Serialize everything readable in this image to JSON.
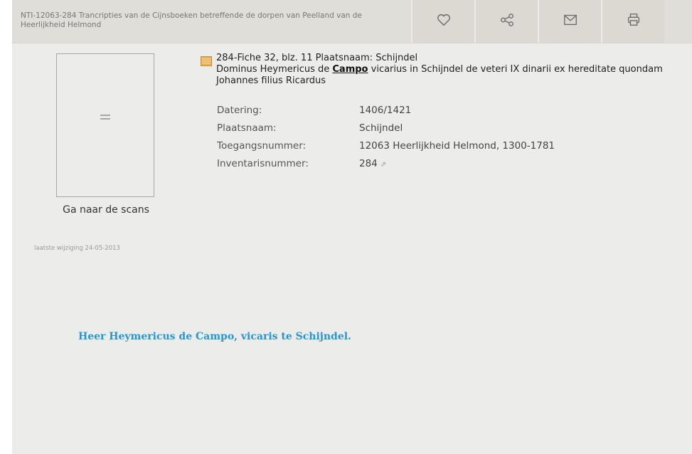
{
  "header": {
    "breadcrumb": "NTI-12063-284 Trancripties van de Cijnsboeken betreffende de dorpen van Peelland van de Heerlijkheid Helmond",
    "actions": [
      {
        "icon": "heart-icon"
      },
      {
        "icon": "share-icon"
      },
      {
        "icon": "mail-icon"
      },
      {
        "icon": "print-icon"
      }
    ]
  },
  "scans": {
    "link_label": "Ga naar de scans",
    "last_modified": "laatste wijziging 24-05-2013"
  },
  "record": {
    "title": "284-Fiche 32, blz. 11 Plaatsnaam: Schijndel",
    "desc_pre": "Dominus Heymericus de ",
    "desc_link": "Campo",
    "desc_post": " vicarius in Schijndel de veteri IX dinarii ex hereditate quondam Johannes filius Ricardus",
    "fields": [
      {
        "label": "Datering:",
        "value": "1406/1421"
      },
      {
        "label": "Plaatsnaam:",
        "value": "Schijndel"
      },
      {
        "label": "Toegangsnummer:",
        "value": "12063 Heerlijkheid Helmond, 1300-1781"
      },
      {
        "label": "Inventarisnummer:",
        "value": "284"
      }
    ]
  },
  "caption": "Heer Heymericus de Campo, vicaris te Schijndel.",
  "colors": {
    "accent": "#2a94d1",
    "topbar": "#e0ded9",
    "background": "#ececeb"
  }
}
